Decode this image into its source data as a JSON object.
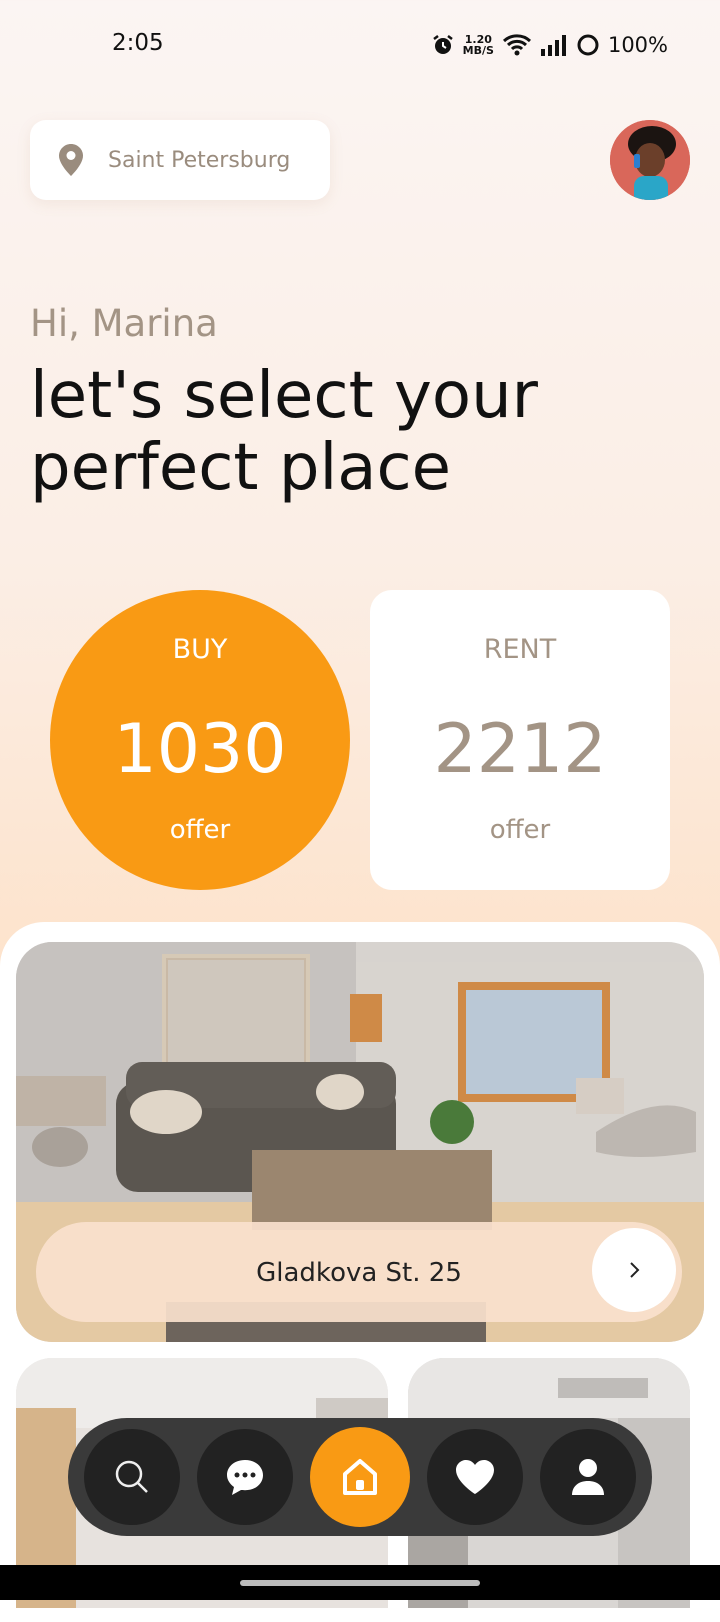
{
  "status_bar": {
    "time": "2:05",
    "speed_value": "1.20",
    "speed_unit": "MB/S",
    "battery": "100%"
  },
  "location": {
    "label": "Saint Petersburg",
    "icon": "location-pin-icon"
  },
  "greeting": {
    "hi": "Hi, Marina",
    "line1": "let's select your",
    "line2": "perfect place"
  },
  "offers": {
    "buy": {
      "label": "BUY",
      "count": "1030",
      "sub": "offer",
      "color": "#f99a14"
    },
    "rent": {
      "label": "RENT",
      "count": "2212",
      "sub": "offer"
    }
  },
  "featured": {
    "address": "Gladkova St. 25"
  },
  "nav": {
    "items": [
      "search-icon",
      "chat-icon",
      "home-icon",
      "heart-icon",
      "user-icon"
    ],
    "active": "home-icon"
  }
}
